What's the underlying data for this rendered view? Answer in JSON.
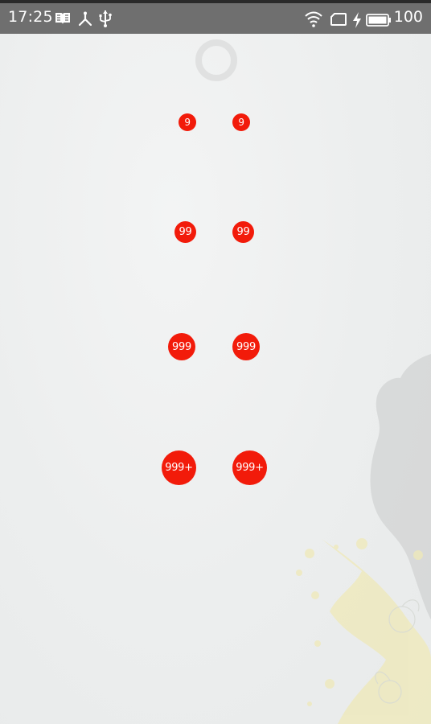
{
  "status_bar": {
    "time": "17:25",
    "battery_level": "100",
    "icons": [
      "book-icon",
      "share-icon",
      "usb-icon",
      "wifi-icon",
      "sim-card-icon",
      "charging-icon",
      "battery-icon"
    ]
  },
  "loading": {
    "icon": "loading-spinner-icon"
  },
  "badges": {
    "row1": {
      "left": "9",
      "right": "9"
    },
    "row2": {
      "left": "99",
      "right": "99"
    },
    "row3": {
      "left": "999",
      "right": "999"
    },
    "row4": {
      "left": "999+",
      "right": "999+"
    }
  },
  "colors": {
    "badge": "#f21b0a",
    "status_bar": "#6f6f6f",
    "background": "#eef0f0"
  }
}
